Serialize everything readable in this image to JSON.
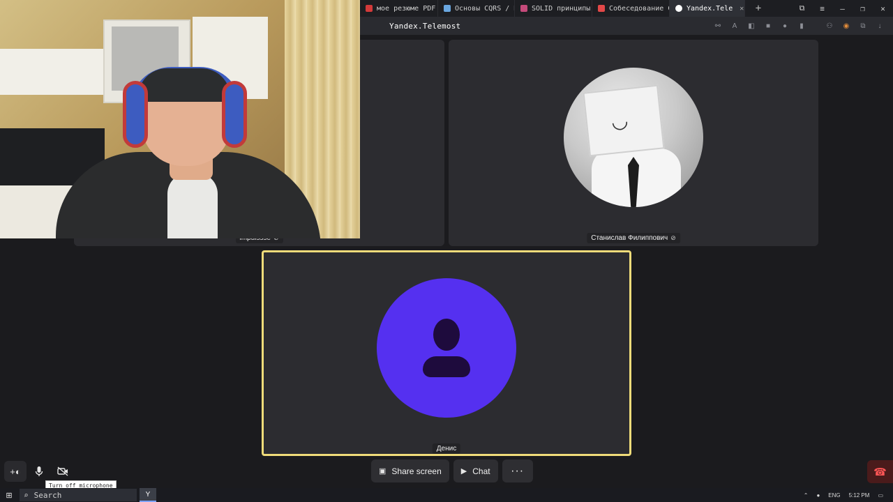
{
  "browser": {
    "tabs": [
      {
        "label": "мое резюме PDF",
        "favicon_color": "#d33a3a",
        "active": false
      },
      {
        "label": "Основы CQRS / Н",
        "favicon_color": "#6aa7e0",
        "active": false
      },
      {
        "label": "SOLID принципы",
        "favicon_color": "#c44a7a",
        "active": false
      },
      {
        "label": "Собеседование С",
        "favicon_color": "#e24848",
        "active": false
      },
      {
        "label": "Yandex.Tele",
        "favicon_color": "#ffffff",
        "active": true
      }
    ],
    "new_tab_label": "+",
    "window_controls": [
      "⧉",
      "≡",
      "–",
      "❐",
      "✕"
    ],
    "site_title": "Yandex.Telemost"
  },
  "participants": {
    "left_tile_name": "impulssse",
    "right_tile_name": "Станислав Филиппович",
    "main_tile_name": "Денис"
  },
  "controls": {
    "tooltip": "Turn off microphone",
    "share_screen_label": "Share screen",
    "chat_label": "Chat",
    "more_label": "···"
  },
  "taskbar": {
    "search_placeholder": "Search",
    "language": "ENG",
    "time": "5:12 PM"
  },
  "colors": {
    "active_speaker_border": "#f0dc7a",
    "avatar_purple": "#5530f0",
    "hangup": "#ff5656"
  }
}
